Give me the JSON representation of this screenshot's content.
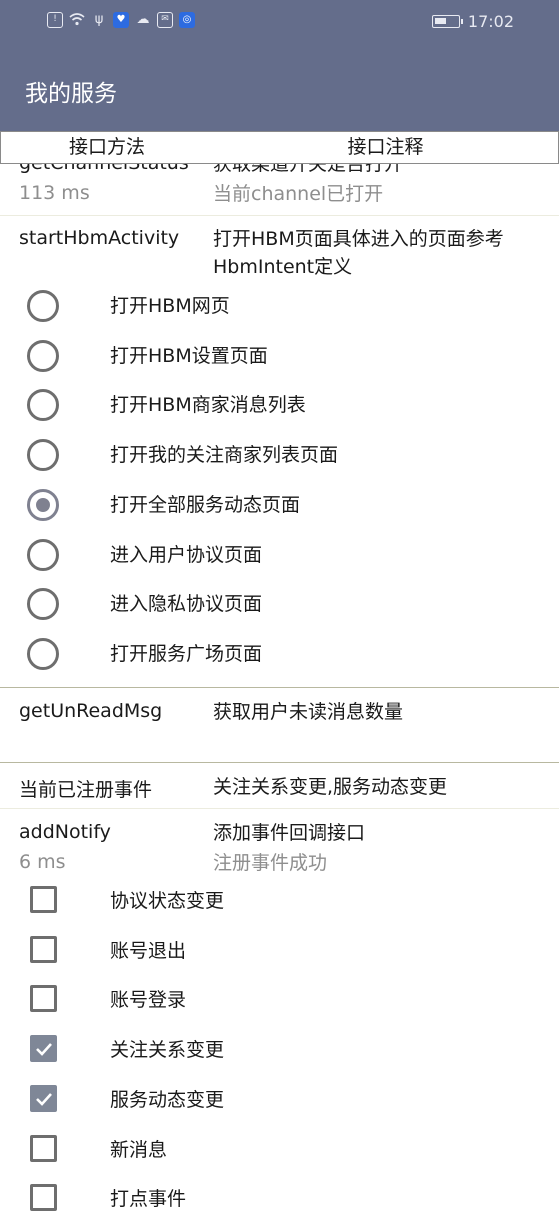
{
  "status_bar": {
    "time": "17:02",
    "icons": [
      "alert-icon",
      "wifi-icon",
      "usb-icon",
      "app-icon",
      "cloud-icon",
      "mail-icon",
      "shield-icon"
    ]
  },
  "app_bar": {
    "title": "我的服务"
  },
  "table_header": {
    "col1": "接口方法",
    "col2": "接口注释"
  },
  "rows": {
    "channel": {
      "method": "getChannelStatus",
      "desc": "获取渠道开关是否打开",
      "time": "113 ms",
      "result": "当前channel已打开"
    },
    "hbm": {
      "method": "startHbmActivity",
      "desc": "打开HBM页面具体进入的页面参考HbmIntent定义"
    },
    "unread": {
      "method": "getUnReadMsg",
      "desc": "获取用户未读消息数量"
    },
    "registered": {
      "method": "当前已注册事件",
      "desc": "关注关系变更,服务动态变更"
    },
    "notify": {
      "method": "addNotify",
      "desc": "添加事件回调接口",
      "time": "6 ms",
      "result": "注册事件成功"
    }
  },
  "hbm_options": [
    {
      "label": "打开HBM网页",
      "selected": false
    },
    {
      "label": "打开HBM设置页面",
      "selected": false
    },
    {
      "label": "打开HBM商家消息列表",
      "selected": false
    },
    {
      "label": "打开我的关注商家列表页面",
      "selected": false
    },
    {
      "label": "打开全部服务动态页面",
      "selected": true
    },
    {
      "label": "进入用户协议页面",
      "selected": false
    },
    {
      "label": "进入隐私协议页面",
      "selected": false
    },
    {
      "label": "打开服务广场页面",
      "selected": false
    }
  ],
  "notify_options": [
    {
      "label": "协议状态变更",
      "checked": false
    },
    {
      "label": "账号退出",
      "checked": false
    },
    {
      "label": "账号登录",
      "checked": false
    },
    {
      "label": "关注关系变更",
      "checked": true
    },
    {
      "label": "服务动态变更",
      "checked": true
    },
    {
      "label": "新消息",
      "checked": false
    },
    {
      "label": "打点事件",
      "checked": false
    }
  ],
  "colors": {
    "app_bar": "#646d8b",
    "accent": "#7f8797",
    "divider": "#d8d8c0"
  },
  "battery_level": 0.5
}
